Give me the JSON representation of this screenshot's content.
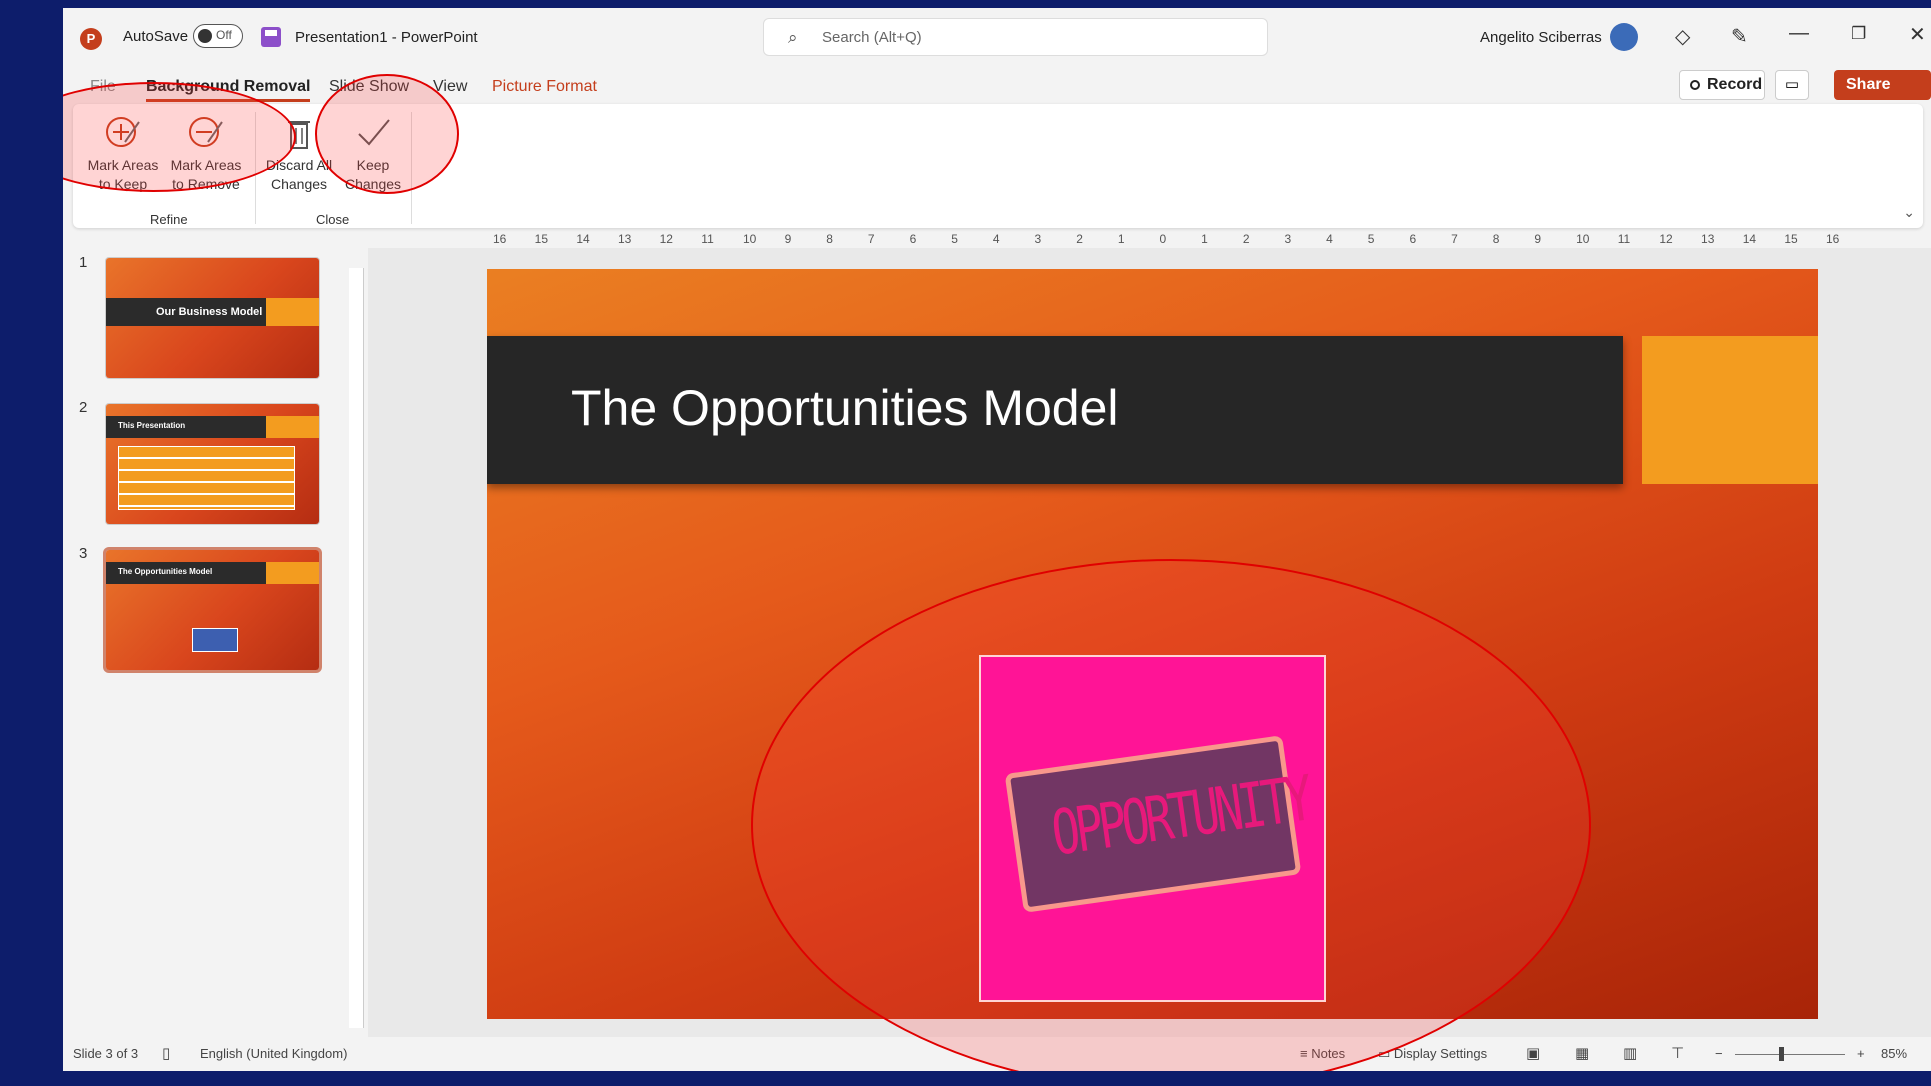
{
  "titlebar": {
    "autosave_label": "AutoSave",
    "autosave_state": "Off",
    "doc_title": "Presentation1 - PowerPoint",
    "search_placeholder": "Search (Alt+Q)",
    "user_name": "Angelito Sciberras"
  },
  "tabs": {
    "file": "File",
    "background_removal": "Background Removal",
    "slide_show": "Slide Show",
    "view": "View",
    "picture_format": "Picture Format"
  },
  "actions": {
    "record": "Record",
    "share": "Share"
  },
  "ribbon": {
    "mark_keep": [
      "Mark Areas",
      "to Keep"
    ],
    "mark_remove": [
      "Mark Areas",
      "to Remove"
    ],
    "discard": [
      "Discard All",
      "Changes"
    ],
    "keep_changes": [
      "Keep",
      "Changes"
    ],
    "group_refine": "Refine",
    "group_close": "Close"
  },
  "thumbnails": [
    {
      "number": "1",
      "title": "Our Business Model"
    },
    {
      "number": "2",
      "title": "This Presentation"
    },
    {
      "number": "3",
      "title": "The Opportunities Model"
    }
  ],
  "ruler": {
    "h_ticks": [
      "16",
      "15",
      "14",
      "13",
      "12",
      "11",
      "10",
      "9",
      "8",
      "7",
      "6",
      "5",
      "4",
      "3",
      "2",
      "1",
      "0",
      "1",
      "2",
      "3",
      "4",
      "5",
      "6",
      "7",
      "8",
      "9",
      "10",
      "11",
      "12",
      "13",
      "14",
      "15",
      "16"
    ]
  },
  "slide": {
    "title": "The Opportunities Model",
    "stamp_text": "OPPORTUNITY"
  },
  "statusbar": {
    "slide_info": "Slide 3 of 3",
    "language": "English (United Kingdom)",
    "notes": "Notes",
    "display_settings": "Display Settings",
    "zoom": "85%"
  },
  "colors": {
    "accent": "#c43e1c",
    "highlight": "#e00000"
  }
}
